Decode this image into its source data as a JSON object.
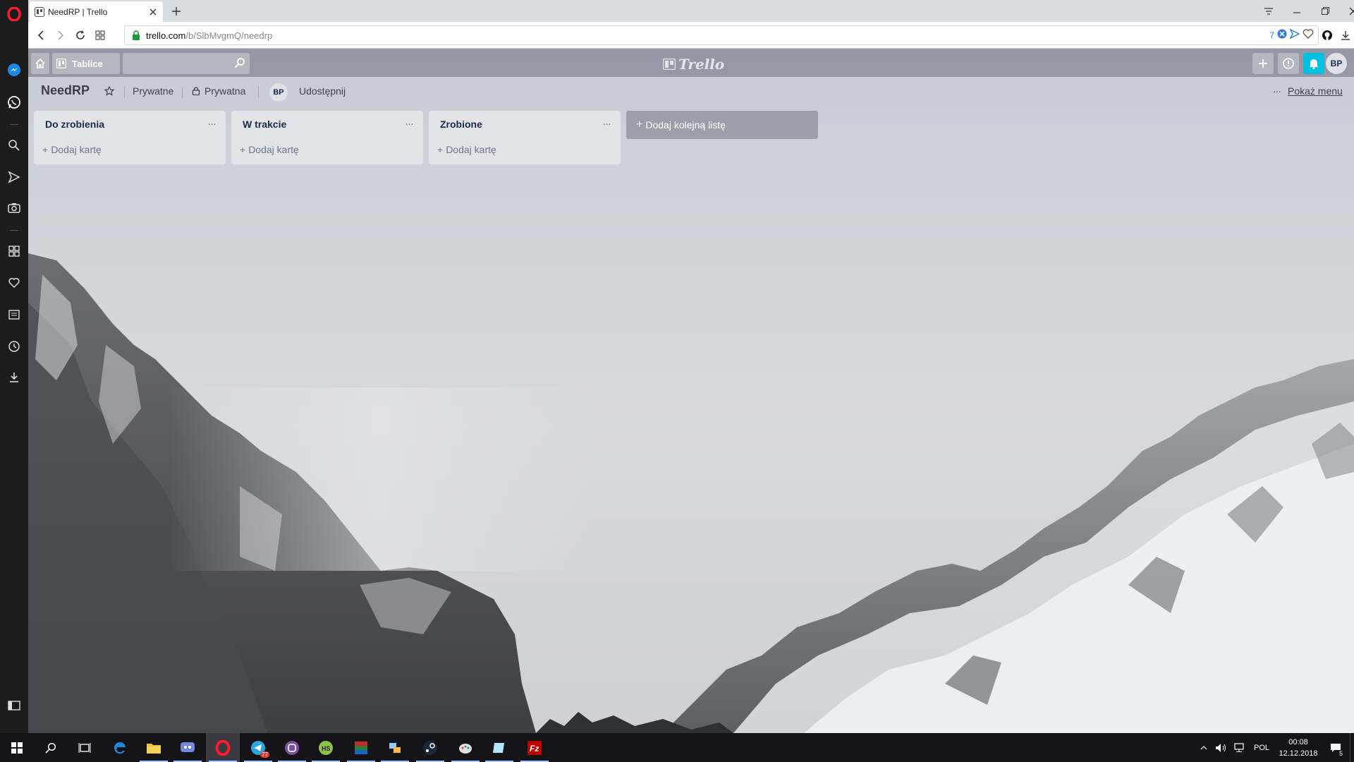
{
  "browser": {
    "tab_title": "NeedRP | Trello",
    "url_host": "trello.com",
    "url_path": "/b/SlbMvgmQ/needrp",
    "badge_count": "7"
  },
  "trello": {
    "header": {
      "boards_label": "Tablice",
      "search_placeholder": "",
      "logo_text": "Trello",
      "avatar_initials": "BP"
    },
    "board": {
      "title": "NeedRP",
      "team_label": "Prywatne",
      "visibility_label": "Prywatna",
      "member_initials": "BP",
      "share_label": "Udostępnij",
      "show_menu_label": "Pokaż menu"
    },
    "lists": [
      {
        "title": "Do zrobienia",
        "add_card": "Dodaj kartę"
      },
      {
        "title": "W trakcie",
        "add_card": "Dodaj kartę"
      },
      {
        "title": "Zrobione",
        "add_card": "Dodaj kartę"
      }
    ],
    "add_list_label": "Dodaj kolejną listę"
  },
  "taskbar": {
    "language": "POL",
    "time": "00:08",
    "date": "12.12.2018",
    "notification_count": "5",
    "telegram_badge": "77",
    "apps": [
      "start-icon",
      "search-icon",
      "task-view-icon",
      "edge-icon",
      "file-explorer-icon",
      "discord-icon",
      "opera-icon",
      "telegram-icon",
      "viber-icon",
      "hotspot-shield-icon",
      "winrar-icon",
      "network-app-icon",
      "steam-icon",
      "paint-app-icon",
      "notes-app-icon",
      "filezilla-icon"
    ]
  },
  "colors": {
    "trello_header": "#6e6e7d",
    "notification_button": "#00c2e0",
    "list_bg": "#e2e4e8",
    "sidebar_bg": "#1c1c1c",
    "opera_red": "#ff1b2d"
  }
}
